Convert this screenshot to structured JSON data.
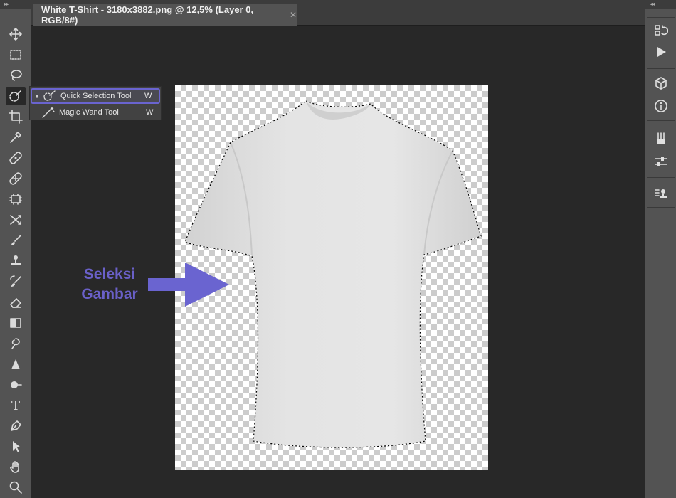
{
  "document_tab": {
    "title": "White T-Shirt - 3180x3882.png @ 12,5% (Layer 0, RGB/8#)",
    "close_glyph": "✕"
  },
  "toolbar": {
    "grip": "▸▸",
    "tools": [
      {
        "name": "move-tool",
        "icon": "move-icon"
      },
      {
        "name": "rectangular-marquee-tool",
        "icon": "marquee-icon"
      },
      {
        "name": "lasso-tool",
        "icon": "lasso-icon"
      },
      {
        "name": "quick-selection-tool",
        "icon": "quick-selection-icon",
        "active": true
      },
      {
        "name": "crop-tool",
        "icon": "crop-icon"
      },
      {
        "name": "eyedropper-tool",
        "icon": "eyedropper-icon"
      },
      {
        "name": "healing-brush-tool",
        "icon": "bandage-icon"
      },
      {
        "name": "patch-tool",
        "icon": "patch-icon"
      },
      {
        "name": "frame-tool",
        "icon": "frame-icon"
      },
      {
        "name": "content-aware-move-tool",
        "icon": "cross-arrows-icon"
      },
      {
        "name": "brush-tool",
        "icon": "brush-icon"
      },
      {
        "name": "clone-stamp-tool",
        "icon": "stamp-icon"
      },
      {
        "name": "history-brush-tool",
        "icon": "history-brush-icon"
      },
      {
        "name": "eraser-tool",
        "icon": "eraser-icon"
      },
      {
        "name": "gradient-tool",
        "icon": "gradient-icon"
      },
      {
        "name": "smudge-tool",
        "icon": "smudge-icon"
      },
      {
        "name": "sharpen-tool",
        "icon": "triangle-icon"
      },
      {
        "name": "dodge-tool",
        "icon": "dodge-icon"
      },
      {
        "name": "type-tool",
        "icon": "type-icon"
      },
      {
        "name": "pen-tool",
        "icon": "pen-icon"
      },
      {
        "name": "path-selection-tool",
        "icon": "arrow-cursor-icon"
      },
      {
        "name": "hand-tool",
        "icon": "hand-icon"
      },
      {
        "name": "zoom-tool",
        "icon": "zoom-icon"
      }
    ],
    "type_glyph": "T"
  },
  "flyout": {
    "items": [
      {
        "label": "Quick Selection Tool",
        "shortcut": "W",
        "bullet": "■"
      },
      {
        "label": "Magic Wand Tool",
        "shortcut": "W",
        "bullet": ""
      }
    ]
  },
  "annotation": {
    "line1": "Seleksi",
    "line2": "Gambar",
    "color": "#6a60c8"
  },
  "right_dock": {
    "grip": "◂◂",
    "buttons": [
      {
        "name": "history-panel",
        "icon": "history-icon"
      },
      {
        "name": "actions-panel",
        "icon": "play-icon"
      },
      {
        "name": "3d-panel",
        "icon": "cube-icon"
      },
      {
        "name": "info-panel",
        "icon": "info-icon"
      },
      {
        "name": "brushes-panel",
        "icon": "brushes-icon"
      },
      {
        "name": "adjustments-panel",
        "icon": "sliders-icon"
      },
      {
        "name": "clone-source-panel",
        "icon": "clone-source-icon"
      }
    ]
  },
  "colors": {
    "workspace": "#282828",
    "panel": "#535353",
    "accent": "#6a64d0"
  }
}
